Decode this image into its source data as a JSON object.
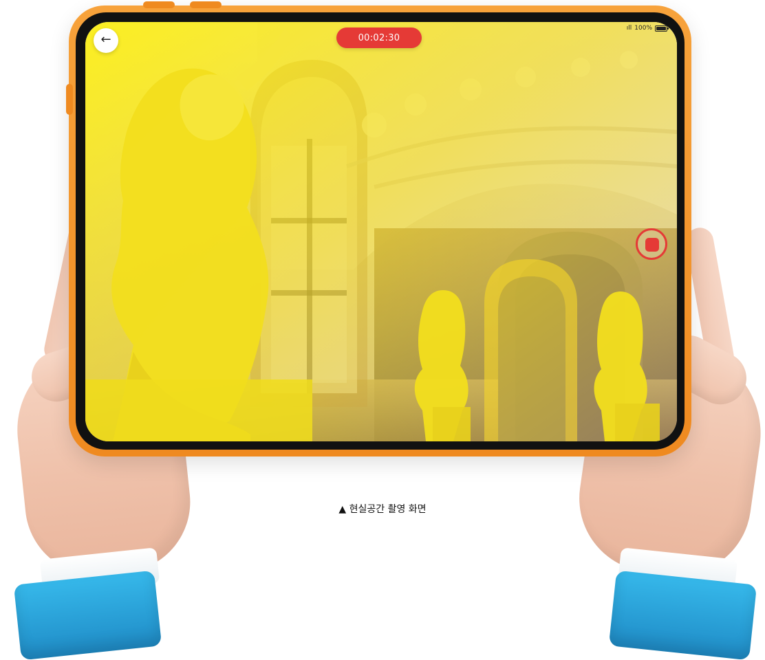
{
  "status_bar": {
    "signal": "ıll",
    "battery_text": "100%"
  },
  "recording": {
    "timer": "00:02:30"
  },
  "controls": {
    "back_icon": "←"
  },
  "caption": "▲ 현실공간 촬영 화면",
  "colors": {
    "tablet_frame": "#ef8a20",
    "accent_red": "#e53a36",
    "sleeve_blue": "#1f8cc7"
  }
}
